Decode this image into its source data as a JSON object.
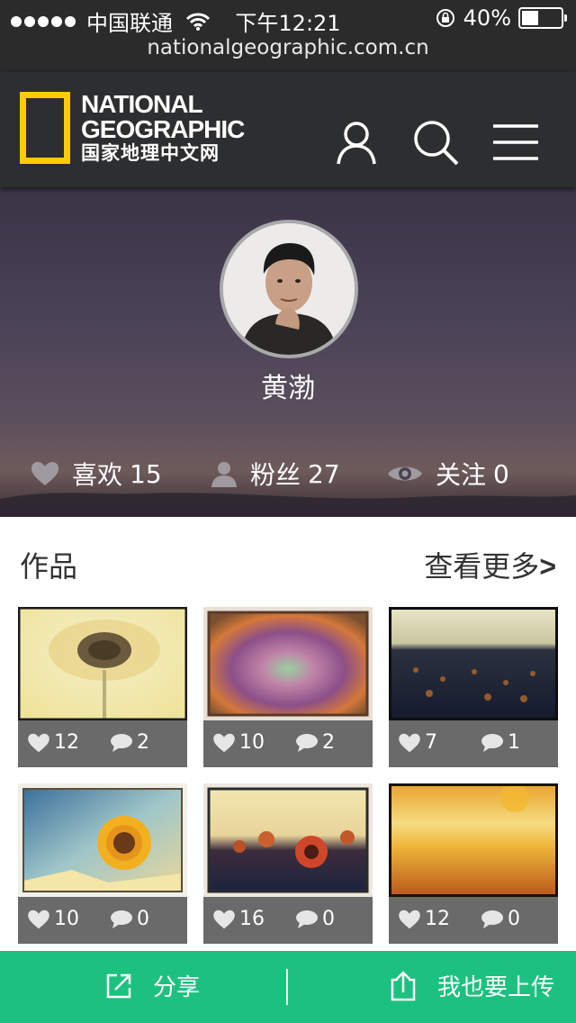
{
  "status_bar": {
    "carrier": "中国联通",
    "time": "下午12:21",
    "battery_percent": "40%",
    "battery_level": 0.4
  },
  "url": "nationalgeographic.com.cn",
  "header": {
    "logo_line1": "NATIONAL",
    "logo_line2": "GEOGRAPHIC",
    "logo_line3": "国家地理中文网",
    "brand_color": "#ffcc00"
  },
  "profile": {
    "name": "黄渤",
    "stats": [
      {
        "label": "喜欢",
        "value": "15",
        "icon": "heart-icon"
      },
      {
        "label": "粉丝",
        "value": "27",
        "icon": "person-icon"
      },
      {
        "label": "关注",
        "value": "0",
        "icon": "eye-icon"
      }
    ]
  },
  "works": {
    "title": "作品",
    "more_label": "查看更多",
    "more_arrow": ">",
    "items": [
      {
        "likes": "12",
        "comments": "2"
      },
      {
        "likes": "10",
        "comments": "2"
      },
      {
        "likes": "7",
        "comments": "1"
      },
      {
        "likes": "10",
        "comments": "0"
      },
      {
        "likes": "16",
        "comments": "0"
      },
      {
        "likes": "12",
        "comments": "0"
      }
    ]
  },
  "bottom_bar": {
    "share_label": "分享",
    "upload_label": "我也要上传",
    "accent": "#1dc17f"
  }
}
